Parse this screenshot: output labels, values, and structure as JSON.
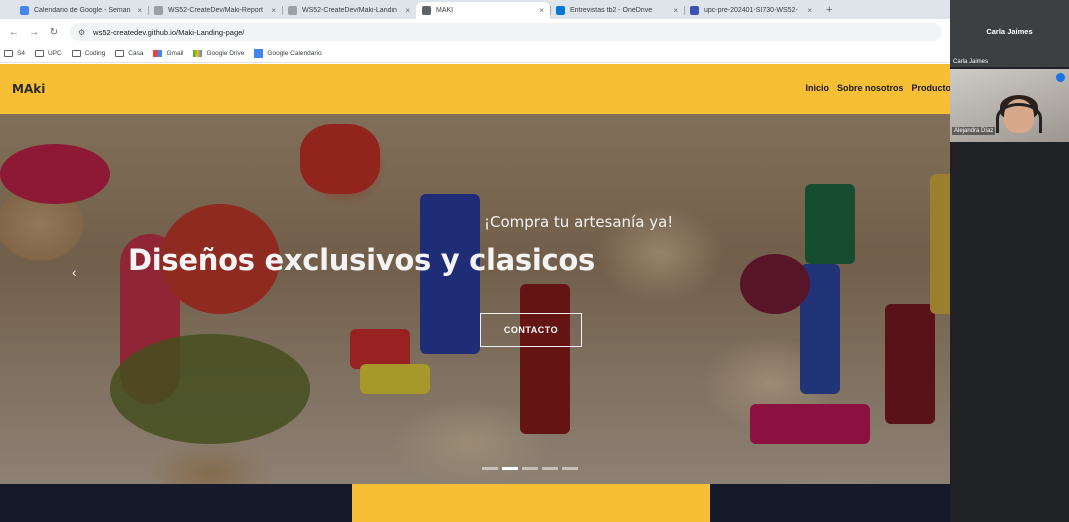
{
  "browser": {
    "tabs": [
      {
        "title": "Calendario de Google - Seman",
        "favicon_color": "#4285f4",
        "active": false
      },
      {
        "title": "WS52-CreateDev/Maki-Report",
        "favicon_color": "#9aa0a6",
        "active": false
      },
      {
        "title": "WS52-CreateDev/Maki-Landin",
        "favicon_color": "#9aa0a6",
        "active": false
      },
      {
        "title": "MAKI",
        "favicon_color": "#5f6368",
        "active": true
      },
      {
        "title": "Entrevistas tb2 - OneDrive",
        "favicon_color": "#0078d4",
        "active": false
      },
      {
        "title": "upc-pre-202401-SI730-WS52-",
        "favicon_color": "#3f51b5",
        "active": false
      }
    ],
    "tab_close_glyph": "×",
    "new_tab_glyph": "+",
    "url": "ws52-createdev.github.io/Maki-Landing-page/",
    "bookmarks": [
      {
        "label": "S4",
        "icon": "folder-icon"
      },
      {
        "label": "UPC",
        "icon": "folder-icon"
      },
      {
        "label": "Coding",
        "icon": "folder-icon"
      },
      {
        "label": "Casa",
        "icon": "folder-icon"
      },
      {
        "label": "Gmail",
        "icon": "gmail-icon"
      },
      {
        "label": "Google Drive",
        "icon": "drive-icon"
      },
      {
        "label": "Google Calendario",
        "icon": "calendar-icon"
      }
    ]
  },
  "site": {
    "brand": "MAki",
    "menu": [
      "Inicio",
      "Sobre nosotros",
      "Productos"
    ],
    "hero": {
      "subtitle": "¡Compra tu artesanía ya!",
      "title": "Diseños exclusivos y clasicos",
      "cta": "CONTACTO",
      "slides": 5,
      "active_slide": 2
    },
    "colors": {
      "brand_yellow": "#f7bf35",
      "footer_navy": "#16192a"
    }
  },
  "meet": {
    "participant_1_name": "Carla Jaimes",
    "participant_1_label": "Carla Jaimes",
    "participant_2_label": "Alejandra Díaz"
  }
}
